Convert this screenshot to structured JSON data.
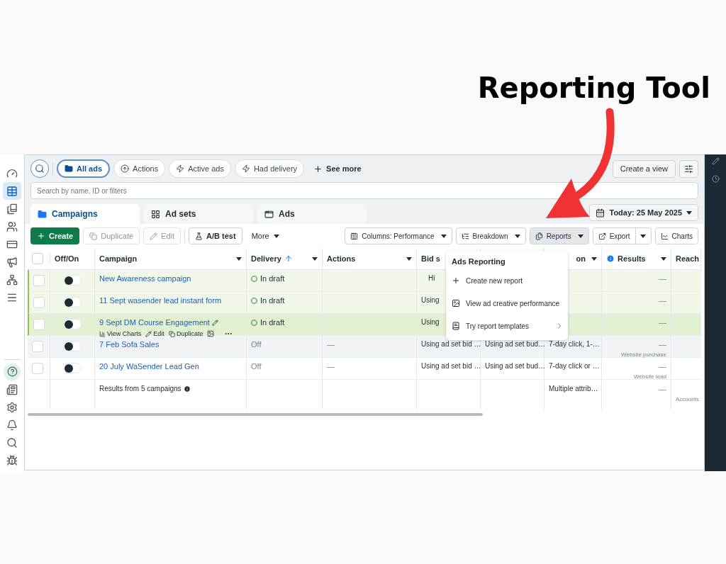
{
  "annotation": {
    "text": "Reporting Tool"
  },
  "sidebar": {
    "top": [
      {
        "kind": "gauge",
        "selected": false
      },
      {
        "kind": "table",
        "selected": true
      },
      {
        "kind": "pages",
        "selected": false
      },
      {
        "kind": "people",
        "selected": false
      },
      {
        "kind": "card",
        "selected": false
      },
      {
        "kind": "megaphone",
        "selected": false
      },
      {
        "kind": "network",
        "selected": false
      },
      {
        "kind": "menu",
        "selected": false
      }
    ],
    "bottom": [
      {
        "kind": "help",
        "selected": false
      },
      {
        "kind": "news",
        "selected": false
      },
      {
        "kind": "settings",
        "selected": false
      },
      {
        "kind": "bell",
        "selected": false
      },
      {
        "kind": "search",
        "selected": false
      },
      {
        "kind": "bug",
        "selected": false
      }
    ]
  },
  "filters": [
    {
      "label": "All ads",
      "kind": "folder",
      "selected": true
    },
    {
      "label": "Actions",
      "kind": "upload",
      "selected": false
    },
    {
      "label": "Active ads",
      "kind": "bolt",
      "selected": false
    },
    {
      "label": "Had delivery",
      "kind": "bolt",
      "selected": false
    }
  ],
  "see_more": "See more",
  "create_view": "Create a view",
  "search": {
    "placeholder": "Search by name, ID or filters"
  },
  "tabs": [
    {
      "label": "Campaigns",
      "kind": "campaign",
      "selected": true
    },
    {
      "label": "Ad sets",
      "kind": "grid",
      "selected": false
    },
    {
      "label": "Ads",
      "kind": "window",
      "selected": false
    }
  ],
  "date": "Today: 25 May 2025",
  "toolbar_left": [
    {
      "label": "Create",
      "kind": "create",
      "disabled": false
    },
    {
      "label": "Duplicate",
      "kind": "duplicate",
      "disabled": true
    },
    {
      "label": "Edit",
      "kind": "edit",
      "disabled": true
    },
    {
      "label": "A/B test",
      "kind": "flask",
      "disabled": false
    },
    {
      "label": "More",
      "kind": "more",
      "disabled": false
    }
  ],
  "toolbar_right": [
    {
      "label": "Columns: Performance",
      "kind": "columns",
      "active": false
    },
    {
      "label": "Breakdown",
      "kind": "breakdown",
      "active": false
    },
    {
      "label": "Reports",
      "kind": "reports",
      "active": true
    },
    {
      "label": "Export",
      "kind": "export",
      "active": false
    },
    {
      "label": "Charts",
      "kind": "charts",
      "active": false
    }
  ],
  "table": {
    "select_all": {
      "checked": false
    },
    "columns": [
      {
        "label": "Off/On",
        "caret": false,
        "sorted": false,
        "info": false
      },
      {
        "label": "Campaign",
        "caret": true,
        "sorted": false,
        "info": false
      },
      {
        "label": "Delivery",
        "caret": true,
        "sorted": true,
        "info": false
      },
      {
        "label": "Actions",
        "caret": true,
        "sorted": false,
        "info": false
      },
      {
        "label": "Bid s"
      },
      {},
      {
        "label": "on",
        "caret": true,
        "sorted": false,
        "info": false
      },
      {
        "label": "Results",
        "caret": true,
        "sorted": false,
        "info": true
      },
      {
        "label": "Reach",
        "info": false
      }
    ],
    "rows": [
      {
        "checked": false,
        "on": false,
        "draft": true,
        "hovered": false,
        "shaded": false,
        "name": "New Awareness campaign",
        "delivery": {
          "text": "In draft",
          "kind": "draft"
        },
        "bid": "Hi",
        "results": "—"
      },
      {
        "checked": false,
        "on": false,
        "draft": true,
        "hovered": false,
        "shaded": false,
        "name": "11 Sept wasender lead instant form",
        "delivery": {
          "text": "In draft",
          "kind": "draft"
        },
        "bid": "Using",
        "results": "—"
      },
      {
        "checked": false,
        "on": false,
        "draft": true,
        "hovered": true,
        "shaded": false,
        "name": "9 Sept DM Course Engagement",
        "hover_actions": [
          "View Charts",
          "Edit",
          "Duplicate"
        ],
        "delivery": {
          "text": "In draft",
          "kind": "draft"
        },
        "bid": "Using",
        "results": "—"
      },
      {
        "checked": false,
        "on": false,
        "draft": false,
        "hovered": false,
        "shaded": true,
        "name": "7 Feb Sofa Sales",
        "delivery": {
          "text": "Off",
          "kind": "off"
        },
        "actions": "—",
        "bid": "Using ad set bid …",
        "budget": "Using ad set bud…",
        "attribution": "7-day click, 1-…",
        "results": "—",
        "results_note": "Website purchase"
      },
      {
        "checked": false,
        "on": false,
        "draft": false,
        "hovered": false,
        "shaded": false,
        "name": "20 July WaSender Lead Gen",
        "delivery": {
          "text": "Off",
          "kind": "off"
        },
        "actions": "—",
        "bid": "Using ad set bid …",
        "budget": "Using ad set bud…",
        "attribution": "7-day click or …",
        "results": "—",
        "results_note": "Website lead"
      }
    ],
    "summary": {
      "label": "Results from 5 campaigns",
      "attribution": "Multiple attrib…",
      "results": "—",
      "reach": "Accounts"
    }
  },
  "menu": {
    "title": "Ads Reporting",
    "items": [
      {
        "label": "Create new report",
        "kind": "plus",
        "submenu": false
      },
      {
        "label": "View ad creative performance",
        "kind": "image",
        "submenu": false
      },
      {
        "label": "Try report templates",
        "kind": "book",
        "submenu": true
      }
    ]
  }
}
